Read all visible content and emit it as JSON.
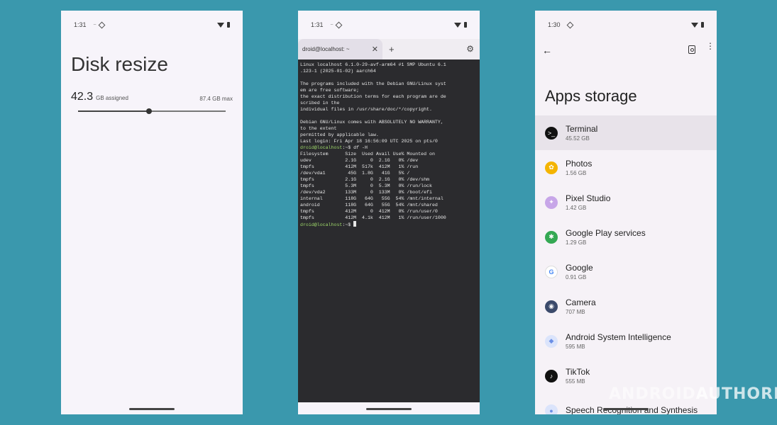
{
  "phone1": {
    "status_time": "1:31",
    "title": "Disk resize",
    "assigned_value": "42.3",
    "assigned_unit": "GB assigned",
    "max_label": "87.4 GB max",
    "slider_fraction": 0.48
  },
  "phone2": {
    "status_time": "1:31",
    "tab_label": "droid@localhost: ~",
    "close_glyph": "✕",
    "add_glyph": "+",
    "settings_glyph": "⚙",
    "terminal_lines": [
      {
        "text": "Linux localhost 6.1.0-29-avf-arm64 #1 SMP Ubuntu 6.1",
        "prompt": false
      },
      {
        "text": ".123-1 (2025-01-02) aarch64",
        "prompt": false
      },
      {
        "text": "",
        "prompt": false
      },
      {
        "text": "The programs included with the Debian GNU/Linux syst",
        "prompt": false
      },
      {
        "text": "em are free software;",
        "prompt": false
      },
      {
        "text": "the exact distribution terms for each program are de",
        "prompt": false
      },
      {
        "text": "scribed in the",
        "prompt": false
      },
      {
        "text": "individual files in /usr/share/doc/*/copyright.",
        "prompt": false
      },
      {
        "text": "",
        "prompt": false
      },
      {
        "text": "Debian GNU/Linux comes with ABSOLUTELY NO WARRANTY,",
        "prompt": false
      },
      {
        "text": "to the extent",
        "prompt": false
      },
      {
        "text": "permitted by applicable law.",
        "prompt": false
      },
      {
        "text": "Last login: Fri Apr 18 16:56:09 UTC 2025 on pts/0",
        "prompt": false
      },
      {
        "prompt_text": "droid@localhost",
        "text": ":~$ df -H",
        "prompt": true
      },
      {
        "text": "Filesystem      Size  Used Avail Use% Mounted on",
        "prompt": false
      },
      {
        "text": "udev            2.1G     0  2.1G   0% /dev",
        "prompt": false
      },
      {
        "text": "tmpfs           412M  517k  412M   1% /run",
        "prompt": false
      },
      {
        "text": "/dev/vda1        45G  1.8G   41G   5% /",
        "prompt": false
      },
      {
        "text": "tmpfs           2.1G     0  2.1G   0% /dev/shm",
        "prompt": false
      },
      {
        "text": "tmpfs           5.3M     0  5.3M   0% /run/lock",
        "prompt": false
      },
      {
        "text": "/dev/vda2       133M     0  133M   0% /boot/efi",
        "prompt": false
      },
      {
        "text": "internal        118G   64G   55G  54% /mnt/internal",
        "prompt": false
      },
      {
        "text": "android         118G   64G   55G  54% /mnt/shared",
        "prompt": false
      },
      {
        "text": "tmpfs           412M     0  412M   0% /run/user/0",
        "prompt": false
      },
      {
        "text": "tmpfs           412M  4.1k  412M   1% /run/user/1000",
        "prompt": false
      },
      {
        "prompt_text": "droid@localhost",
        "text": ":~$ ",
        "prompt": true,
        "cursor": true
      }
    ]
  },
  "phone3": {
    "status_time": "1:30",
    "back_glyph": "←",
    "more_glyph": "⋮",
    "title": "Apps storage",
    "apps": [
      {
        "name": "Terminal",
        "size": "45.52 GB",
        "icon": "terminal-icon",
        "color": "#111111",
        "glyph": ">_",
        "selected": true
      },
      {
        "name": "Photos",
        "size": "1.56 GB",
        "icon": "photos-icon",
        "color": "#f4b400",
        "glyph": "✿",
        "selected": false
      },
      {
        "name": "Pixel Studio",
        "size": "1.42 GB",
        "icon": "pixel-studio-icon",
        "color": "#c7a6e8",
        "glyph": "✦",
        "selected": false
      },
      {
        "name": "Google Play services",
        "size": "1.29 GB",
        "icon": "play-services-icon",
        "color": "#34a853",
        "glyph": "✱",
        "selected": false
      },
      {
        "name": "Google",
        "size": "0.91 GB",
        "icon": "google-icon",
        "color": "#ffffff",
        "glyph": "G",
        "selected": false
      },
      {
        "name": "Camera",
        "size": "707 MB",
        "icon": "camera-icon",
        "color": "#3b4a6b",
        "glyph": "◉",
        "selected": false
      },
      {
        "name": "Android System Intelligence",
        "size": "595 MB",
        "icon": "asi-icon",
        "color": "#dbe4fb",
        "glyph": "◆",
        "selected": false
      },
      {
        "name": "TikTok",
        "size": "555 MB",
        "icon": "tiktok-icon",
        "color": "#111111",
        "glyph": "♪",
        "selected": false
      },
      {
        "name": "Speech Recognition and Synthesis",
        "size": "",
        "icon": "speech-icon",
        "color": "#dbe4fb",
        "glyph": "●",
        "selected": false
      }
    ]
  },
  "watermark": {
    "part1": "ANDROID",
    "part2": "AUTHORITY"
  }
}
